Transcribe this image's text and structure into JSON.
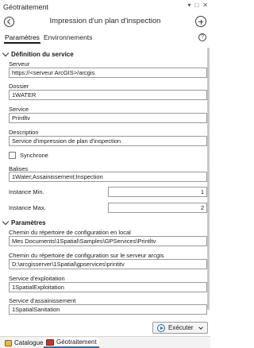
{
  "window": {
    "title": "Géotraitement",
    "controls": [
      "▾",
      "□",
      "✕"
    ]
  },
  "tool": {
    "title": "Impression d'un plan d'inspection"
  },
  "tabs": {
    "parameters": "Paramètres",
    "environments": "Environnements"
  },
  "sections": {
    "service_def": "Définition du service",
    "parameters": "Paramètres"
  },
  "fields": {
    "server_label": "Serveur",
    "server_value": "https://<serveur ArcGIS>/arcgis",
    "folder_label": "Dossier",
    "folder_value": "1WATER",
    "service_label": "Service",
    "service_value": "Printltv",
    "description_label": "Description",
    "description_value": "Service d'impression de plan d'inspection",
    "synchronous_label": "Synchrone",
    "tags_label": "Balises",
    "tags_value": "1Water;Assainissement;Inspection",
    "min_label": "Instance Min.",
    "min_value": "1",
    "max_label": "Instance Max.",
    "max_value": "2",
    "local_config_label": "Chemin du répertoire de configuration en local",
    "local_config_value": "Mes Documents\\1Spatial\\Samples\\GPServices\\Printltv",
    "server_config_label": "Chemin du répertoire de configuration sur le serveur arcgis",
    "server_config_value": "D:\\arcgisserver\\1Spatial\\gpservices\\printitv",
    "exploit_label": "Service d'exploitation",
    "exploit_value": "1SpatialExploitation",
    "sanit_label": "Service d'assainissement",
    "sanit_value": "1SpatialSanitation"
  },
  "actions": {
    "run_label": "Exécuter"
  },
  "bottom_tabs": {
    "catalog": "Catalogue",
    "geoprocessing": "Géotraitement"
  },
  "icons": [
    "back-icon",
    "add-icon",
    "help-icon",
    "chevron-down-icon",
    "play-icon",
    "catalog-icon",
    "geoprocessing-icon"
  ],
  "colors": {
    "accent": "#2b6cb0"
  }
}
